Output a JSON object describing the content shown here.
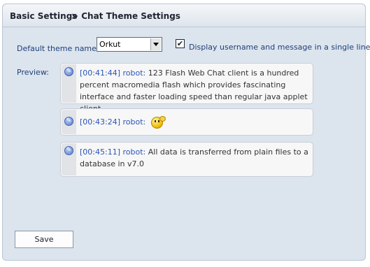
{
  "breadcrumb": {
    "section": "Basic Settings",
    "page": "> Chat Theme Settings"
  },
  "theme": {
    "label": "Default theme name:",
    "selected": "Orkut"
  },
  "single_line": {
    "label": "Display username and message in a single line",
    "checked": true,
    "check_glyph": "✔"
  },
  "preview": {
    "label": "Preview:",
    "messages": [
      {
        "time": "[00:41:44]",
        "user": "robot:",
        "text": "123 Flash Web Chat client is a hundred percent macromedia flash which provides fascinating interface and faster loading speed than regular java applet client."
      },
      {
        "time": "[00:43:24]",
        "user": "robot:",
        "text": "",
        "emoji": "smiley-wave-icon"
      },
      {
        "time": "[00:45:11]",
        "user": "robot:",
        "text": "All data is transferred from plain files to a database in v7.0"
      }
    ]
  },
  "actions": {
    "save_label": "Save"
  },
  "icons": {
    "message": "user-bubble-icon",
    "dropdown": "chevron-down-icon"
  },
  "colors": {
    "panel_bg": "#dce4ee",
    "label_blue": "#1f3f77",
    "timestamp_blue": "#2a55b8"
  }
}
